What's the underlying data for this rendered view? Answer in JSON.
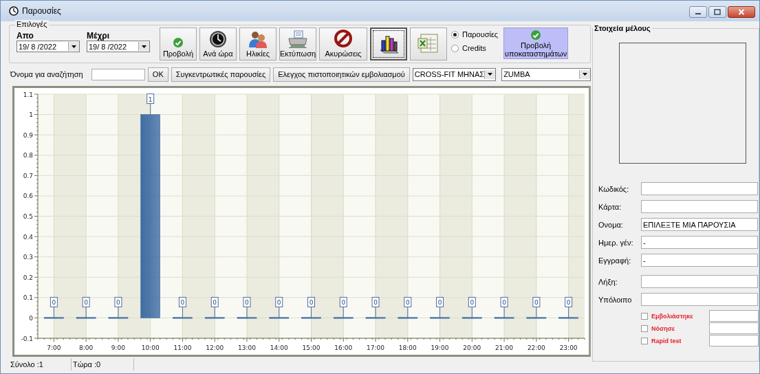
{
  "window": {
    "title": "Παρουσίες"
  },
  "filters": {
    "group_label": "Επιλογές",
    "from_label": "Απο",
    "from_value": "19/ 8 /2022",
    "to_label": "Μέχρι",
    "to_value": "19/ 8 /2022"
  },
  "toolbar": [
    {
      "label": "Προβολή",
      "pressed": false
    },
    {
      "label": "Ανά ώρα",
      "pressed": false
    },
    {
      "label": "Ηλικίες",
      "pressed": false
    },
    {
      "label": "Εκτύπωση",
      "pressed": false
    },
    {
      "label": "Ακυρώσεις",
      "pressed": false
    },
    {
      "pressed": true
    },
    {
      "pressed": false
    }
  ],
  "mode_radios": [
    {
      "label": "Παρουσίες",
      "selected": true
    },
    {
      "label": "Credits",
      "selected": false
    }
  ],
  "branches_button": {
    "label": "Προβολή υποκαταστημάτων"
  },
  "search": {
    "label": "Όνομα για αναζήτηση",
    "ok_button": "OK",
    "summary_button": "Συγκεντρωτικές παρουσίες",
    "vaccination_button": "Ελεγχος πιστοποιητικών εμβολιασμού",
    "program_dropdown": "CROSS-FIT  ΜΗΝΑΣ",
    "class_dropdown": "ZUMBA"
  },
  "chart": {
    "chart_data": {
      "type": "bar",
      "categories": [
        "7:00",
        "8:00",
        "9:00",
        "10:00",
        "11:00",
        "12:00",
        "13:00",
        "14:00",
        "15:00",
        "16:00",
        "17:00",
        "18:00",
        "19:00",
        "20:00",
        "21:00",
        "22:00",
        "23:00"
      ],
      "series": [
        {
          "color": "#3f6da3",
          "values": [
            0,
            0,
            0,
            1,
            0,
            0,
            0,
            0,
            0,
            0,
            0,
            0,
            0,
            0,
            0,
            0,
            0
          ]
        }
      ],
      "ylim": [
        -0.1,
        1.1
      ],
      "yticks": [
        {
          "value": -0.1,
          "label": "-0.1"
        },
        {
          "value": 0,
          "label": "0"
        },
        {
          "value": 0.1,
          "label": "0.1"
        },
        {
          "value": 0.2,
          "label": "0.2"
        },
        {
          "value": 0.3,
          "label": "0.3"
        },
        {
          "value": 0.4,
          "label": "0.4"
        },
        {
          "value": 0.5,
          "label": "0.5"
        },
        {
          "value": 0.6,
          "label": "0.6"
        },
        {
          "value": 0.7,
          "label": "0.7"
        },
        {
          "value": 0.8,
          "label": "0.8"
        },
        {
          "value": 0.9,
          "label": "0.9"
        },
        {
          "value": 1,
          "label": "1"
        },
        {
          "value": 1.1,
          "label": "1.1"
        }
      ],
      "grid": true,
      "data_labels": true
    }
  },
  "status_bar": [
    "Σύνολο :1",
    "Τώρα :0"
  ],
  "member_panel": {
    "title": "Στοιχεία μέλους",
    "fields": [
      {
        "label": "Κωδικός:"
      },
      {
        "label": "Κάρτα:"
      },
      {
        "label": "Ονομα:",
        "value": "ΕΠΙΛΕΞΤΕ ΜΙΑ ΠΑΡΟΥΣΙΑ"
      },
      {
        "label": "Ημερ. γέν:",
        "value": "-"
      },
      {
        "label": "Εγγραφή:",
        "value": "-"
      },
      {
        "label": "Λήξη:"
      },
      {
        "label": "Υπόλοιπο"
      }
    ],
    "checks": [
      {
        "label": "Εμβολιάστηκε",
        "checked": false
      },
      {
        "label": "Νόσησε",
        "checked": false
      },
      {
        "label": "Rapid test",
        "checked": false
      }
    ]
  }
}
